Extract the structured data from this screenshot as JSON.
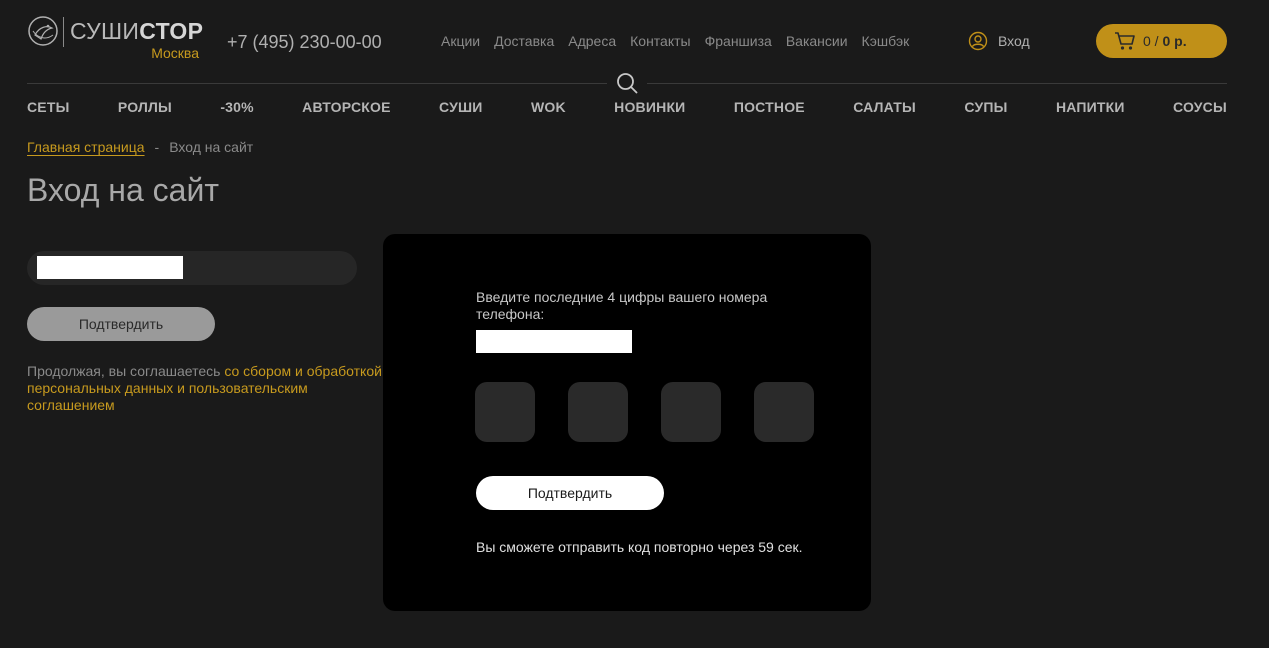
{
  "colors": {
    "accent": "#c09018",
    "background": "#1a1a1a",
    "modal": "#000000"
  },
  "header": {
    "logo": {
      "name_light": "СУШИ",
      "name_bold": "СТОР",
      "city": "Москва"
    },
    "phone": "+7 (495) 230-00-00",
    "top_nav": [
      "Акции",
      "Доставка",
      "Адреса",
      "Контакты",
      "Франшиза",
      "Вакансии",
      "Кэшбэк"
    ],
    "login_label": "Вход",
    "cart": {
      "count": "0 /",
      "sum": "0 р."
    }
  },
  "categories": [
    "СЕТЫ",
    "РОЛЛЫ",
    "-30%",
    "АВТОРСКОЕ",
    "СУШИ",
    "WOK",
    "НОВИНКИ",
    "ПОСТНОЕ",
    "САЛАТЫ",
    "СУПЫ",
    "НАПИТКИ",
    "СОУСЫ"
  ],
  "breadcrumb": {
    "home": "Главная страница",
    "separator": "-",
    "current": "Вход на сайт"
  },
  "page": {
    "title": "Вход на сайт",
    "confirm_label": "Подтвердить",
    "agree_text": "Продолжая, вы соглашаетесь",
    "agree_link": "со сбором и обработкой персональных данных и пользовательским соглашением"
  },
  "modal": {
    "prompt": "Введите последние 4 цифры вашего номера телефона:",
    "digits": [
      "",
      "",
      "",
      ""
    ],
    "confirm_label": "Подтвердить",
    "resend_text": "Вы сможете отправить код повторно через 59 сек."
  }
}
